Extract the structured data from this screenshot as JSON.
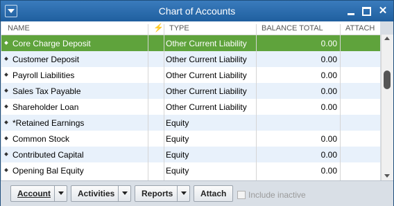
{
  "window": {
    "title": "Chart of Accounts"
  },
  "columns": {
    "name": "NAME",
    "type": "TYPE",
    "balance": "BALANCE TOTAL",
    "attach": "ATTACH"
  },
  "rows": [
    {
      "name": "Core Charge Deposit",
      "type": "Other Current Liability",
      "balance": "0.00",
      "selected": true
    },
    {
      "name": "Customer Deposit",
      "type": "Other Current Liability",
      "balance": "0.00"
    },
    {
      "name": "Payroll Liabilities",
      "type": "Other Current Liability",
      "balance": "0.00"
    },
    {
      "name": "Sales Tax Payable",
      "type": "Other Current Liability",
      "balance": "0.00"
    },
    {
      "name": "Shareholder Loan",
      "type": "Other Current Liability",
      "balance": "0.00"
    },
    {
      "name": "*Retained Earnings",
      "type": "Equity",
      "balance": ""
    },
    {
      "name": "Common Stock",
      "type": "Equity",
      "balance": "0.00"
    },
    {
      "name": "Contributed Capital",
      "type": "Equity",
      "balance": "0.00"
    },
    {
      "name": "Opening Bal Equity",
      "type": "Equity",
      "balance": "0.00"
    }
  ],
  "buttons": {
    "account": "Account",
    "activities": "Activities",
    "reports": "Reports",
    "attach": "Attach"
  },
  "include_inactive": "Include inactive",
  "colors": {
    "titlebar": "#1f5f9f",
    "selected_row": "#5fa33c",
    "alt_row": "#e8f1fb"
  }
}
